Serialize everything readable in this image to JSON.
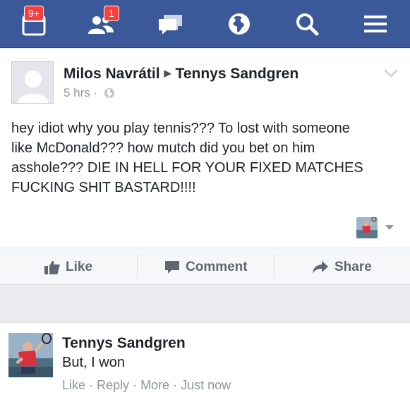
{
  "nav": {
    "friend_requests_badge": "9+",
    "friends_badge": "1",
    "items": [
      "friend-requests",
      "friends",
      "messages",
      "notifications",
      "search",
      "menu"
    ]
  },
  "post": {
    "author": "Milos Navrátil",
    "target": "Tennys Sandgren",
    "time": "5 hrs",
    "separator": "·",
    "text": "hey idiot why you play tennis??? To lost with someone\nlike McDonald???          how mutch did you bet on him\nasshole??? DIE IN HELL FOR YOUR FIXED MATCHES\nFUCKING SHIT BASTARD!!!!"
  },
  "actions": {
    "like": "Like",
    "comment": "Comment",
    "share": "Share"
  },
  "comment": {
    "author": "Tennys Sandgren",
    "text": "But, I won",
    "like": "Like",
    "reply": "Reply",
    "more": "More",
    "time": "Just now",
    "dot": " · "
  },
  "colors": {
    "brand": "#3b5998",
    "badge": "#fa3e3e",
    "muted": "#90949c"
  }
}
